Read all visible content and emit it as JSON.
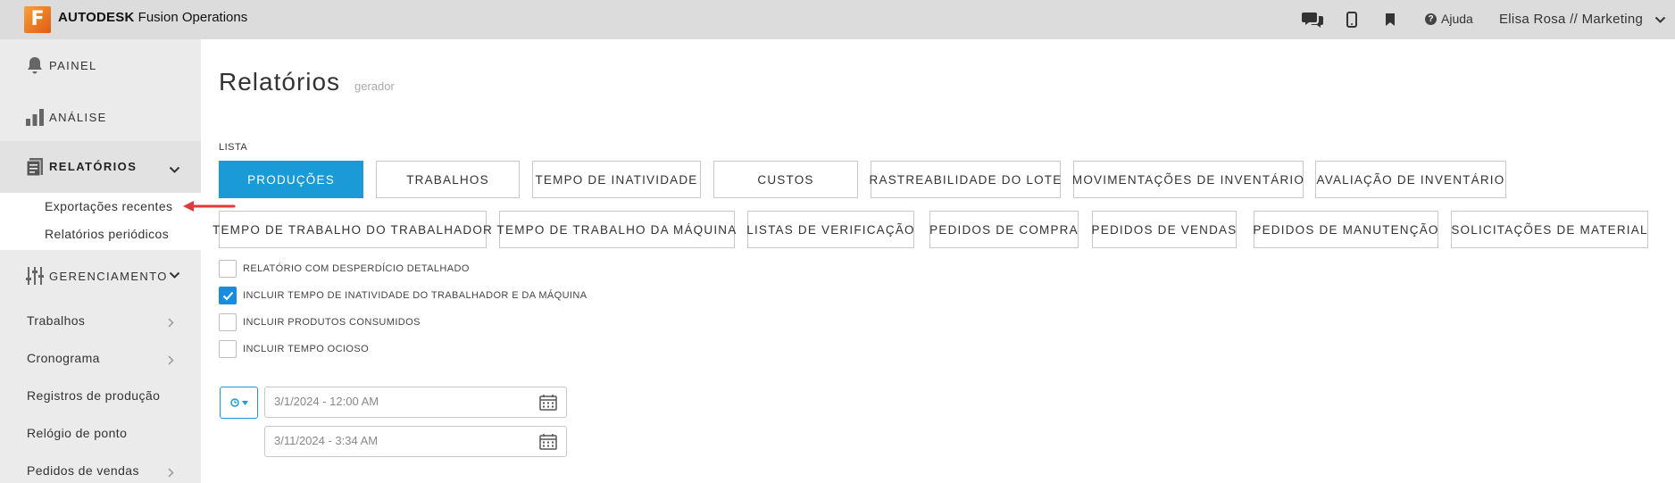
{
  "app": {
    "logo_letter": "F",
    "brand_strong": "AUTODESK",
    "brand_rest": " Fusion Operations",
    "help_label": "Ajuda",
    "user_label": "Elisa Rosa // Marketing",
    "icons": [
      "chat-icon",
      "mobile-icon",
      "bookmark-icon",
      "help-icon",
      "chevron-down-icon"
    ]
  },
  "sidebar": {
    "painel": "PAINEL",
    "analise": "ANÁLISE",
    "relatorios": "RELATÓRIOS",
    "relatorios_sub": [
      "Exportações recentes",
      "Relatórios periódicos"
    ],
    "gerenciamento": "GERENCIAMENTO",
    "gerenciamento_items": [
      "Trabalhos",
      "Cronograma",
      "Registros de produção",
      "Relógio de ponto",
      "Pedidos de vendas"
    ]
  },
  "main": {
    "title": "Relatórios",
    "subtitle": "gerador",
    "list_label": "LISTA",
    "tabs_row1": [
      "PRODUÇÕES",
      "TRABALHOS",
      "TEMPO DE INATIVIDADE",
      "CUSTOS",
      "RASTREABILIDADE DO LOTE",
      "MOVIMENTAÇÕES DE INVENTÁRIO",
      "AVALIAÇÃO DE INVENTÁRIO"
    ],
    "tabs_row2": [
      "TEMPO DE TRABALHO DO TRABALHADOR",
      "TEMPO DE TRABALHO DA MÁQUINA",
      "LISTAS DE VERIFICAÇÃO",
      "PEDIDOS DE COMPRA",
      "PEDIDOS DE VENDAS",
      "PEDIDOS DE MANUTENÇÃO",
      "SOLICITAÇÕES DE MATERIAL"
    ],
    "active_tab": "PRODUÇÕES",
    "options": [
      {
        "label": "RELATÓRIO COM DESPERDÍCIO DETALHADO",
        "checked": false
      },
      {
        "label": "INCLUIR TEMPO DE INATIVIDADE DO TRABALHADOR E DA MÁQUINA",
        "checked": true
      },
      {
        "label": "INCLUIR PRODUTOS CONSUMIDOS",
        "checked": false
      },
      {
        "label": "INCLUIR TEMPO OCIOSO",
        "checked": false
      }
    ],
    "date_start": "3/1/2024 - 12:00 AM",
    "date_end": "3/11/2024 - 3:34 AM"
  },
  "colors": {
    "accent": "#1a9bd7",
    "checkbox": "#1a8ce0",
    "annotation_arrow": "#e0393e",
    "topbar": "#dcdcdc",
    "sidebar": "#ebebeb"
  }
}
